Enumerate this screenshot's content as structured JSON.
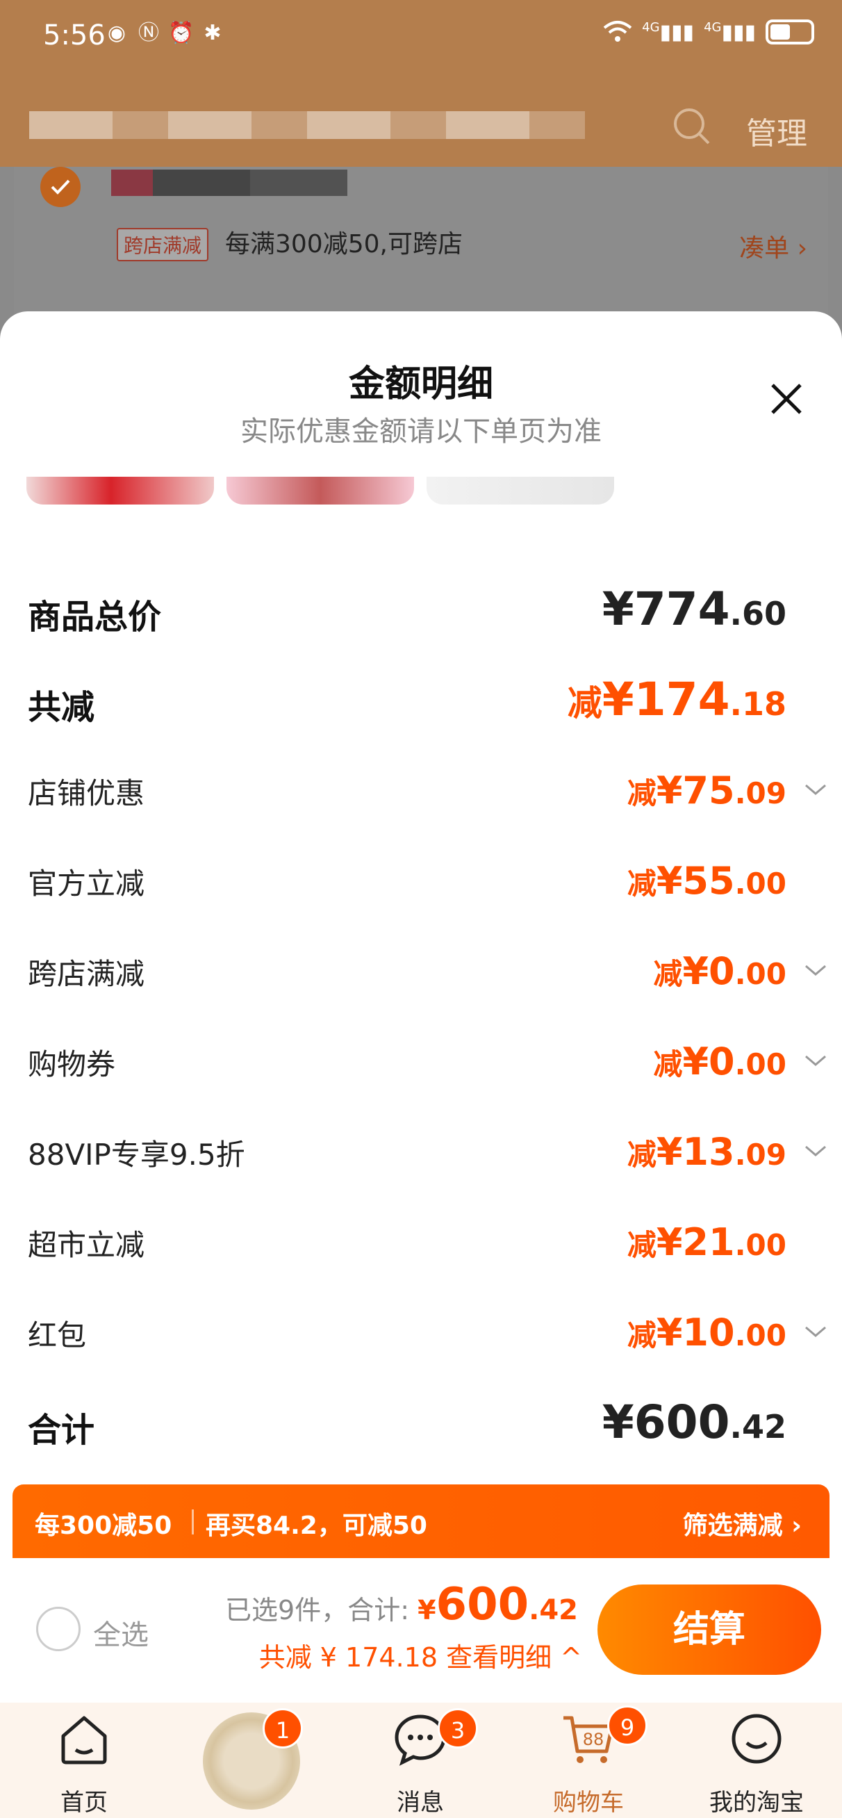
{
  "status_bar": {
    "time": "5:56",
    "left_icons": [
      "app-icon",
      "nfc-icon",
      "alarm-icon",
      "bluetooth-icon"
    ],
    "right_icons": [
      "wifi-icon",
      "signal-4g-icon",
      "signal-4g-icon",
      "battery-icon"
    ],
    "net1": "4G",
    "net2": "4G"
  },
  "background_page": {
    "manage_label": "管理",
    "promo_tag": "跨店满减",
    "promo_text": "每满300减50,可跨店",
    "promo_link": "凑单 ›"
  },
  "sheet": {
    "title": "金额明细",
    "subtitle": "实际优惠金额请以下单页为准",
    "rows": [
      {
        "label": "商品总价",
        "prefix": "",
        "int": "¥774",
        "dec": ".60",
        "style": "total",
        "expand": false
      },
      {
        "label": "共减",
        "prefix": "减",
        "int": "¥174",
        "dec": ".18",
        "style": "discount-total",
        "expand": false
      },
      {
        "label": "店铺优惠",
        "prefix": "减",
        "int": "¥75",
        "dec": ".09",
        "style": "discount",
        "expand": true
      },
      {
        "label": "官方立减",
        "prefix": "减",
        "int": "¥55",
        "dec": ".00",
        "style": "discount",
        "expand": false
      },
      {
        "label": "跨店满减",
        "prefix": "减",
        "int": "¥0",
        "dec": ".00",
        "style": "discount",
        "expand": true
      },
      {
        "label": "购物券",
        "prefix": "减",
        "int": "¥0",
        "dec": ".00",
        "style": "discount",
        "expand": true
      },
      {
        "label": "88VIP专享9.5折",
        "prefix": "减",
        "int": "¥13",
        "dec": ".09",
        "style": "discount",
        "expand": true
      },
      {
        "label": "超市立减",
        "prefix": "减",
        "int": "¥21",
        "dec": ".00",
        "style": "discount",
        "expand": false
      },
      {
        "label": "红包",
        "prefix": "减",
        "int": "¥10",
        "dec": ".00",
        "style": "discount",
        "expand": true
      },
      {
        "label": "合计",
        "prefix": "",
        "int": "¥600",
        "dec": ".42",
        "style": "total",
        "expand": false
      }
    ]
  },
  "promo_bar": {
    "rule": "每300减50",
    "hint": "再买84.2，可减50",
    "action": "筛选满减 ›"
  },
  "checkout": {
    "select_all": "全选",
    "selected_text": "已选9件，合计:",
    "amount_prefix": "¥",
    "amount_int": "600",
    "amount_dec": ".42",
    "saved_text": "共减 ¥ 174.18  查看明细 ^",
    "button": "结算"
  },
  "tabbar": {
    "tabs": [
      {
        "label": "首页",
        "icon": "home-icon",
        "badge": ""
      },
      {
        "label": "",
        "icon": "product-thumbnail",
        "badge": "1"
      },
      {
        "label": "消息",
        "icon": "message-icon",
        "badge": "3"
      },
      {
        "label": "购物车",
        "icon": "cart-icon",
        "badge": "9",
        "icon_text": "88"
      },
      {
        "label": "我的淘宝",
        "icon": "profile-icon",
        "badge": ""
      }
    ]
  },
  "colors": {
    "accent": "#ff5000",
    "header_brown": "#b47e4d",
    "tab_active": "#c66b2b"
  }
}
